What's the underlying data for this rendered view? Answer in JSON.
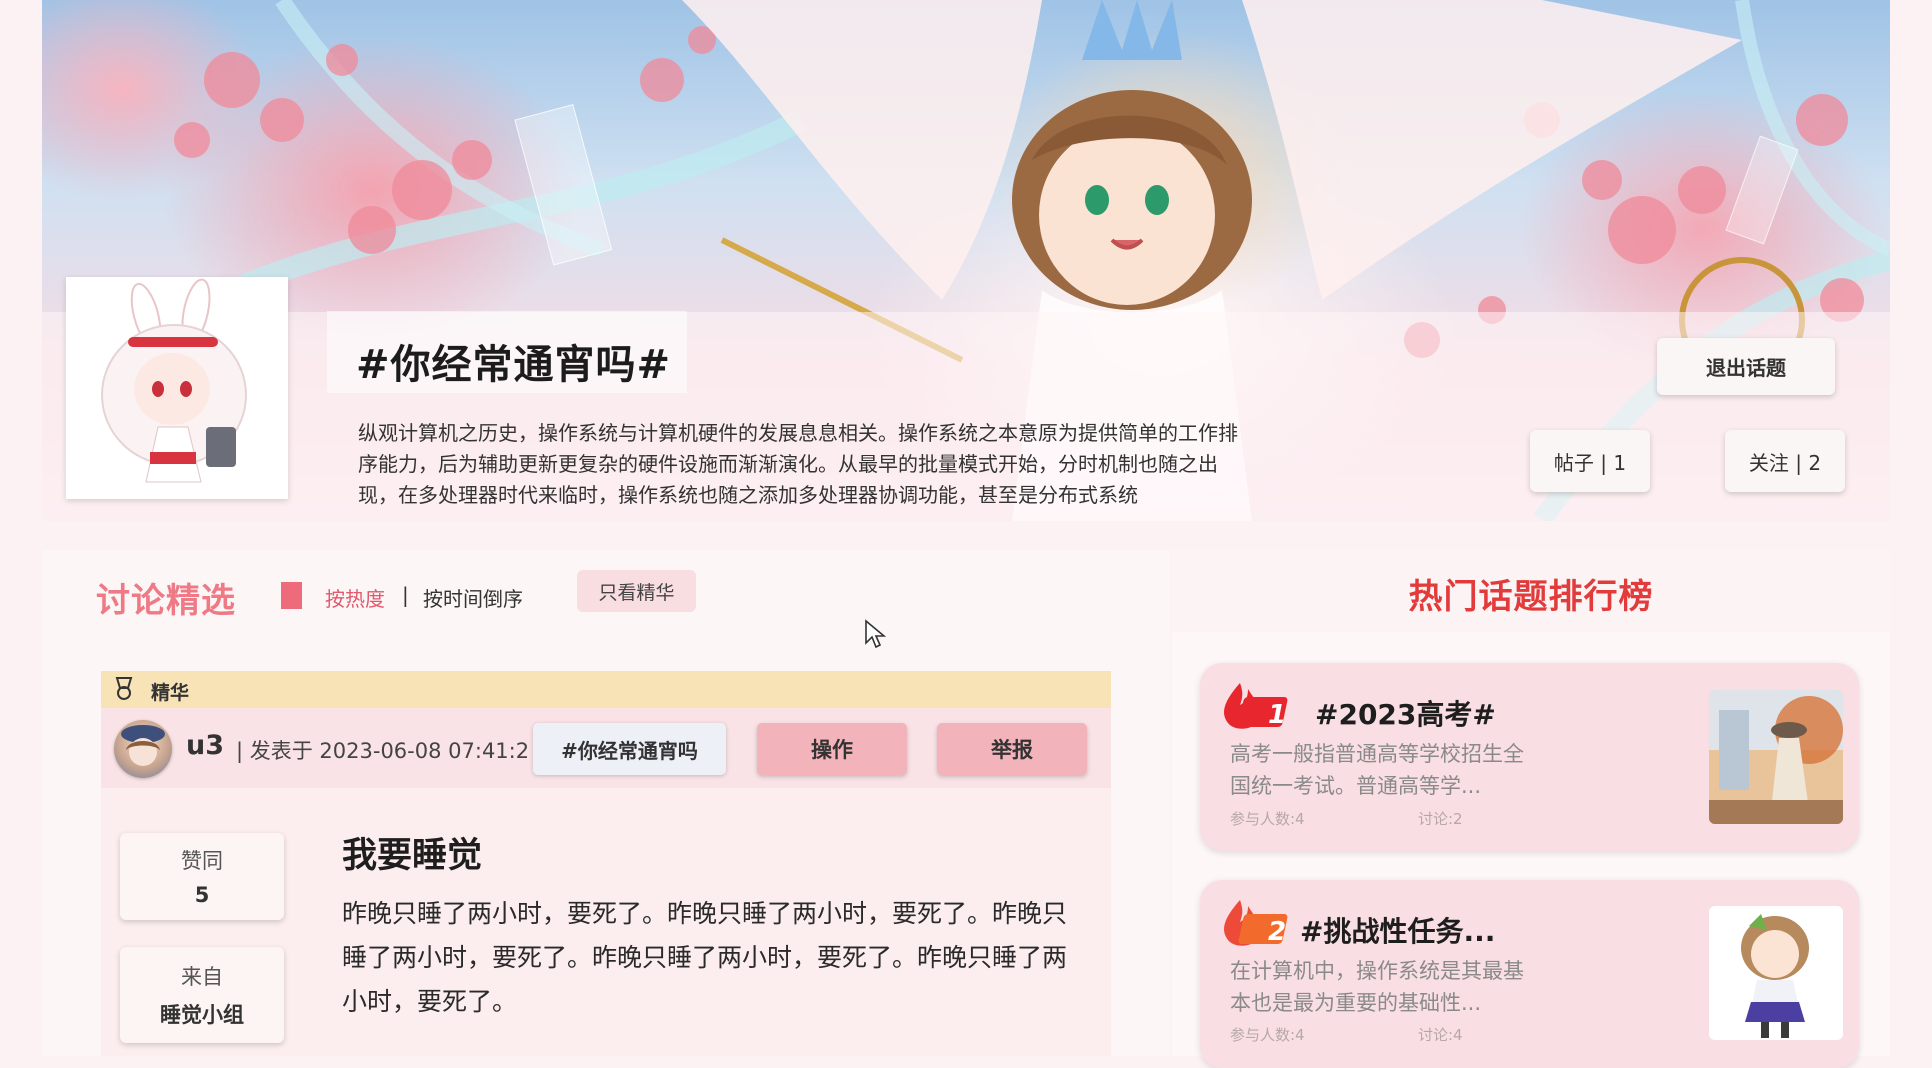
{
  "topic": {
    "title": "#你经常通宵吗#",
    "description": "纵观计算机之历史，操作系统与计算机硬件的发展息息相关。操作系统之本意原为提供简单的工作排序能力，后为辅助更新更复杂的硬件设施而渐渐演化。从最早的批量模式开始，分时机制也随之出现，在多处理器时代来临时，操作系统也随之添加多处理器协调功能，甚至是分布式系统",
    "exit_label": "退出话题",
    "posts_label": "帖子 | 1",
    "follow_label": "关注 | 2"
  },
  "discussion": {
    "title": "讨论精选",
    "sort_hot": "按热度",
    "separator": "|",
    "sort_time": "按时间倒序",
    "only_best_label": "只看精华"
  },
  "post": {
    "best_label": "精华",
    "username": "u3",
    "meta": "|  发表于 2023-06-08 07:41:2",
    "tag": "#你经常通宵吗",
    "action_label": "操作",
    "report_label": "举报",
    "likes_label": "赞同",
    "likes_value": "5",
    "from_label": "来自",
    "from_value": "睡觉小组",
    "title": "我要睡觉",
    "content": "昨晚只睡了两小时，要死了。昨晚只睡了两小时，要死了。昨晚只睡了两小时，要死了。昨晚只睡了两小时，要死了。昨晚只睡了两小时，要死了。"
  },
  "hot_topics": {
    "title": "热门话题排行榜",
    "items": [
      {
        "rank": "1",
        "title": "#2023高考#",
        "desc": "高考一般指普通高等学校招生全国统一考试。普通高等学...",
        "participants": "参与人数:4",
        "discussions": "讨论:2"
      },
      {
        "rank": "2",
        "title": "#挑战性任务...",
        "desc": "在计算机中，操作系统是其最基本也是最为重要的基础性...",
        "participants": "参与人数:4",
        "discussions": "讨论:4"
      }
    ]
  },
  "colors": {
    "accent_pink": "#ee7a85",
    "ranking_red": "#e23b3b",
    "button_pink": "#f3b3bb",
    "best_bar": "#f7e3b6"
  },
  "icons": {
    "best": "medal-icon",
    "rank": "flame-icon",
    "cursor": "mouse-cursor-icon"
  }
}
